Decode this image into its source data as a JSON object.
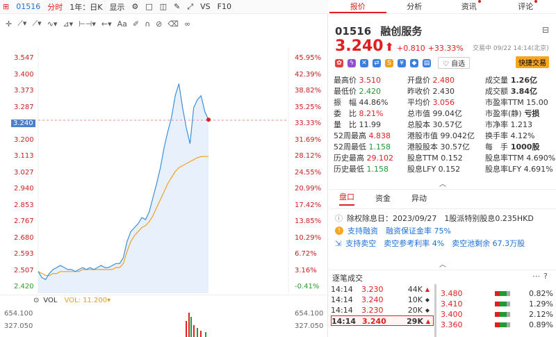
{
  "topbar": {
    "code": "01516",
    "mode": "分时",
    "period": "1年：日K",
    "display": "显示",
    "vs": "VS",
    "f10": "F10"
  },
  "chart": {
    "left_axis": [
      "3.547",
      "3.400",
      "3.373",
      "3.287",
      "3.240",
      "3.200",
      "3.113",
      "3.027",
      "2.940",
      "2.853",
      "2.767",
      "2.680",
      "2.593",
      "2.507",
      "2.420"
    ],
    "right_axis": [
      "45.95%",
      "42.39%",
      "38.82%",
      "35.25%",
      "33.33%",
      "31.69%",
      "28.12%",
      "24.55%",
      "20.99%",
      "17.42%",
      "13.85%",
      "10.29%",
      "6.72%",
      "3.16%",
      "-0.41%"
    ],
    "vol_label": "VOL",
    "vol_value": "VOL: 11.200",
    "vol_axis_top": "654.100",
    "vol_axis_mid": "327.050",
    "colors": {
      "price_line": "#3a8fd8",
      "avg_line": "#f0a020",
      "up": "#e02020",
      "down": "#1f9a34"
    }
  },
  "chart_data": {
    "type": "line",
    "series": [
      {
        "values": [
          2.48,
          2.45,
          2.44,
          2.47,
          2.49,
          2.5,
          2.51,
          2.5,
          2.49,
          2.49,
          2.48,
          2.49,
          2.5,
          2.49,
          2.5,
          2.49,
          2.5,
          2.51,
          2.5,
          2.5,
          2.51,
          2.52,
          2.52,
          2.55,
          2.63,
          2.68,
          2.7,
          2.72,
          2.75,
          2.74,
          2.78,
          2.85,
          2.92,
          3.0,
          3.1,
          3.18,
          3.25,
          3.36,
          3.42,
          3.3,
          3.2,
          3.12,
          3.3,
          3.34,
          3.36,
          3.28,
          3.24
        ]
      },
      {
        "values": [
          2.48,
          2.47,
          2.46,
          2.46,
          2.47,
          2.47,
          2.48,
          2.48,
          2.48,
          2.48,
          2.48,
          2.48,
          2.49,
          2.49,
          2.49,
          2.49,
          2.49,
          2.49,
          2.49,
          2.49,
          2.49,
          2.5,
          2.5,
          2.52,
          2.58,
          2.63,
          2.66,
          2.68,
          2.7,
          2.71,
          2.73,
          2.76,
          2.8,
          2.84,
          2.88,
          2.92,
          2.95,
          2.98,
          3.0,
          3.01,
          3.02,
          3.03,
          3.04,
          3.05,
          3.055,
          3.056,
          3.056
        ]
      }
    ],
    "ylim": [
      2.42,
      3.547
    ]
  },
  "quote": {
    "code": "01516",
    "name": "融创服务",
    "price": "3.240",
    "change": "+0.810",
    "change_pct": "+33.33%",
    "status": "交易中 09/22 14:14(北京)",
    "watch": "自选",
    "quick_trade": "快捷交易"
  },
  "stats": [
    [
      {
        "label": "最高价",
        "value": "3.510",
        "cls": "r"
      },
      {
        "label": "开盘价",
        "value": "2.480",
        "cls": "r"
      },
      {
        "label": "成交量",
        "value": "1.26亿",
        "cls": "bold"
      }
    ],
    [
      {
        "label": "最低价",
        "value": "2.420",
        "cls": "g"
      },
      {
        "label": "昨收价",
        "value": "2.430",
        "cls": ""
      },
      {
        "label": "成交额",
        "value": "3.84亿",
        "cls": "bold"
      }
    ],
    [
      {
        "label": "振　幅",
        "value": "44.86%",
        "cls": ""
      },
      {
        "label": "平均价",
        "value": "3.056",
        "cls": "r"
      },
      {
        "label": "市盈率TTM",
        "value": "15.00",
        "cls": ""
      }
    ],
    [
      {
        "label": "委　比",
        "value": "8.21%",
        "cls": "r"
      },
      {
        "label": "总市值",
        "value": "99.04亿",
        "cls": ""
      },
      {
        "label": "市盈率(静)",
        "value": "亏损",
        "cls": "bold"
      }
    ],
    [
      {
        "label": "量　比",
        "value": "11.99",
        "cls": ""
      },
      {
        "label": "总股本",
        "value": "30.57亿",
        "cls": ""
      },
      {
        "label": "市净率",
        "value": "1.213",
        "cls": ""
      }
    ],
    [
      {
        "label": "52周最高",
        "value": "4.838",
        "cls": "r"
      },
      {
        "label": "港股市值",
        "value": "99.042亿",
        "cls": ""
      },
      {
        "label": "换手率",
        "value": "4.12%",
        "cls": ""
      }
    ],
    [
      {
        "label": "52周最低",
        "value": "1.158",
        "cls": "g"
      },
      {
        "label": "港股股本",
        "value": "30.57亿",
        "cls": ""
      },
      {
        "label": "每　手",
        "value": "1000股",
        "cls": "bold"
      }
    ],
    [
      {
        "label": "历史最高",
        "value": "29.102",
        "cls": "r"
      },
      {
        "label": "股息TTM",
        "value": "0.152",
        "cls": ""
      },
      {
        "label": "股息率TTM",
        "value": "4.690%",
        "cls": ""
      }
    ],
    [
      {
        "label": "历史最低",
        "value": "1.158",
        "cls": "g"
      },
      {
        "label": "股息LFY",
        "value": "0.152",
        "cls": ""
      },
      {
        "label": "股息率LFY",
        "value": "4.691%",
        "cls": ""
      }
    ]
  ],
  "section_tabs": [
    "盘口",
    "资金",
    "异动"
  ],
  "notices": [
    "除权除息日：2023/09/27　1股派特别股息0.235HKD",
    "支持融资　融资保证金率 75%",
    "支持卖空　卖空参考利率 4%　卖空池剩余 67.3万股"
  ],
  "ticks_title": "逐笔成交",
  "ticks": [
    {
      "time": "14:14",
      "price": "3.230",
      "vol": "44K",
      "dir": "▲"
    },
    {
      "time": "14:14",
      "price": "3.240",
      "vol": "10K",
      "dir": "◆"
    },
    {
      "time": "14:14",
      "price": "3.230",
      "vol": "20K",
      "dir": "◆"
    },
    {
      "time": "14:14",
      "price": "3.240",
      "vol": "29K",
      "dir": "▲"
    }
  ],
  "depth": [
    {
      "price": "3.480",
      "pct": "0.82%"
    },
    {
      "price": "3.410",
      "pct": "1.29%"
    },
    {
      "price": "3.400",
      "pct": "2.12%"
    },
    {
      "price": "3.360",
      "pct": "0.89%"
    }
  ]
}
